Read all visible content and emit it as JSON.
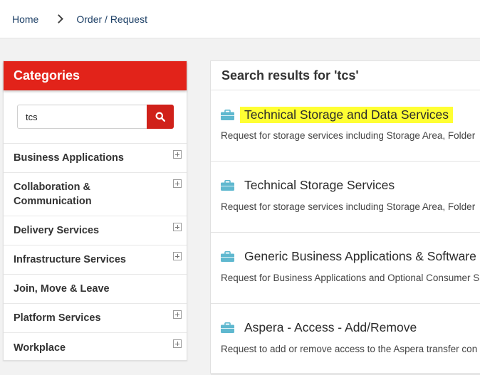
{
  "breadcrumb": {
    "home": "Home",
    "current": "Order / Request"
  },
  "sidebar": {
    "title": "Categories",
    "search": {
      "value": "tcs",
      "placeholder": ""
    },
    "items": [
      {
        "label": "Business Applications",
        "expandable": true
      },
      {
        "label": "Collaboration & Communication",
        "expandable": true
      },
      {
        "label": "Delivery Services",
        "expandable": true
      },
      {
        "label": "Infrastructure Services",
        "expandable": true
      },
      {
        "label": "Join, Move & Leave",
        "expandable": false
      },
      {
        "label": "Platform Services",
        "expandable": true
      },
      {
        "label": "Workplace",
        "expandable": true
      }
    ]
  },
  "results": {
    "heading": "Search results for 'tcs'",
    "items": [
      {
        "title": "Technical Storage and Data Services",
        "description": "Request for storage services including Storage Area, Folder",
        "highlighted": true
      },
      {
        "title": "Technical Storage Services",
        "description": "Request for storage services including Storage Area, Folder",
        "highlighted": false
      },
      {
        "title": "Generic Business Applications & Software",
        "description": "Request for Business Applications and Optional Consumer S",
        "highlighted": false
      },
      {
        "title": "Aspera - Access - Add/Remove",
        "description": "Request to add or remove access to the Aspera transfer con",
        "highlighted": false
      }
    ]
  },
  "colors": {
    "accent_red": "#e2231a",
    "icon_teal": "#5fb8cf",
    "highlight": "#ffff33",
    "link_blue": "#1c3f66"
  },
  "icons": {
    "search": "search-icon",
    "expand": "plus-box-icon",
    "result": "briefcase-icon",
    "separator": "chevron-right-icon"
  }
}
